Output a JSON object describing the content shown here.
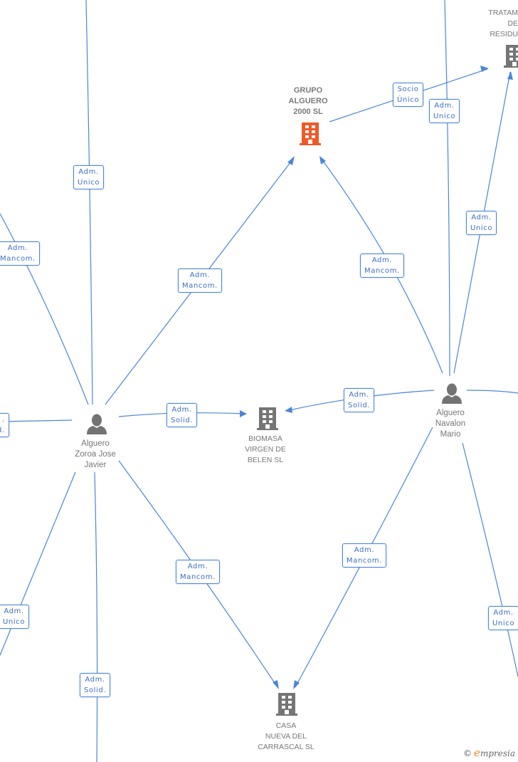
{
  "colors": {
    "edge": "#4a86d8",
    "label_text": "#3a6fc4",
    "main_company": "#f05a28",
    "company": "#757575",
    "person": "#737373",
    "node_text": "#777777"
  },
  "nodes": {
    "grupo_alguero": {
      "type": "company",
      "highlight": true,
      "icon": "building-icon",
      "lines": [
        "GRUPO",
        "ALGUERO",
        "2000 SL"
      ]
    },
    "tratamiento": {
      "type": "company",
      "icon": "building-icon",
      "lines": [
        "TRATAM",
        "DE",
        "RESIDU"
      ]
    },
    "biomasa": {
      "type": "company",
      "icon": "building-icon",
      "lines": [
        "BIOMASA",
        "VIRGEN DE",
        "BELEN SL"
      ]
    },
    "casa_nueva": {
      "type": "company",
      "icon": "building-icon",
      "lines": [
        "CASA",
        "NUEVA DEL",
        "CARRASCAL SL"
      ]
    },
    "alguero_zoroa": {
      "type": "person",
      "icon": "person-icon",
      "lines": [
        "Alguero",
        "Zoroa Jose",
        "Javier"
      ]
    },
    "alguero_navalon": {
      "type": "person",
      "icon": "person-icon",
      "lines": [
        "Alguero",
        "Navalon",
        "Mario"
      ]
    }
  },
  "edge_labels": [
    {
      "id": "socio_unico",
      "lines": [
        "Socio",
        "Único"
      ]
    },
    {
      "id": "adm_unico_top_right",
      "lines": [
        "Adm.",
        "Unico"
      ]
    },
    {
      "id": "adm_unico_top_left",
      "lines": [
        "Adm.",
        "Unico"
      ]
    },
    {
      "id": "adm_mancom_far_left",
      "lines": [
        "Adm.",
        "Mancom."
      ]
    },
    {
      "id": "adm_mancom_zoroa_grupo",
      "lines": [
        "Adm.",
        "Mancom."
      ]
    },
    {
      "id": "adm_mancom_navalon_grupo",
      "lines": [
        "Adm.",
        "Mancom."
      ]
    },
    {
      "id": "adm_unico_navalon_tratam",
      "lines": [
        "Adm.",
        "Unico"
      ]
    },
    {
      "id": "adm_solid_left_edge",
      "lines": [
        ".",
        "d."
      ]
    },
    {
      "id": "adm_solid_zoroa_biomasa",
      "lines": [
        "Adm.",
        "Solid."
      ]
    },
    {
      "id": "adm_solid_navalon_biomasa",
      "lines": [
        "Adm.",
        "Solid."
      ]
    },
    {
      "id": "adm_mancom_zoroa_casa",
      "lines": [
        "Adm.",
        "Mancom."
      ]
    },
    {
      "id": "adm_mancom_navalon_casa",
      "lines": [
        "Adm.",
        "Mancom."
      ]
    },
    {
      "id": "adm_unico_bottom_left",
      "lines": [
        "Adm.",
        "Unico"
      ]
    },
    {
      "id": "adm_solid_bottom",
      "lines": [
        "Adm.",
        "Solid."
      ]
    },
    {
      "id": "adm_unico_bottom_right",
      "lines": [
        "Adm.",
        "Unico"
      ]
    }
  ],
  "footer": {
    "copyright": "©",
    "brand_initial": "e",
    "brand_rest": "mpresia"
  }
}
